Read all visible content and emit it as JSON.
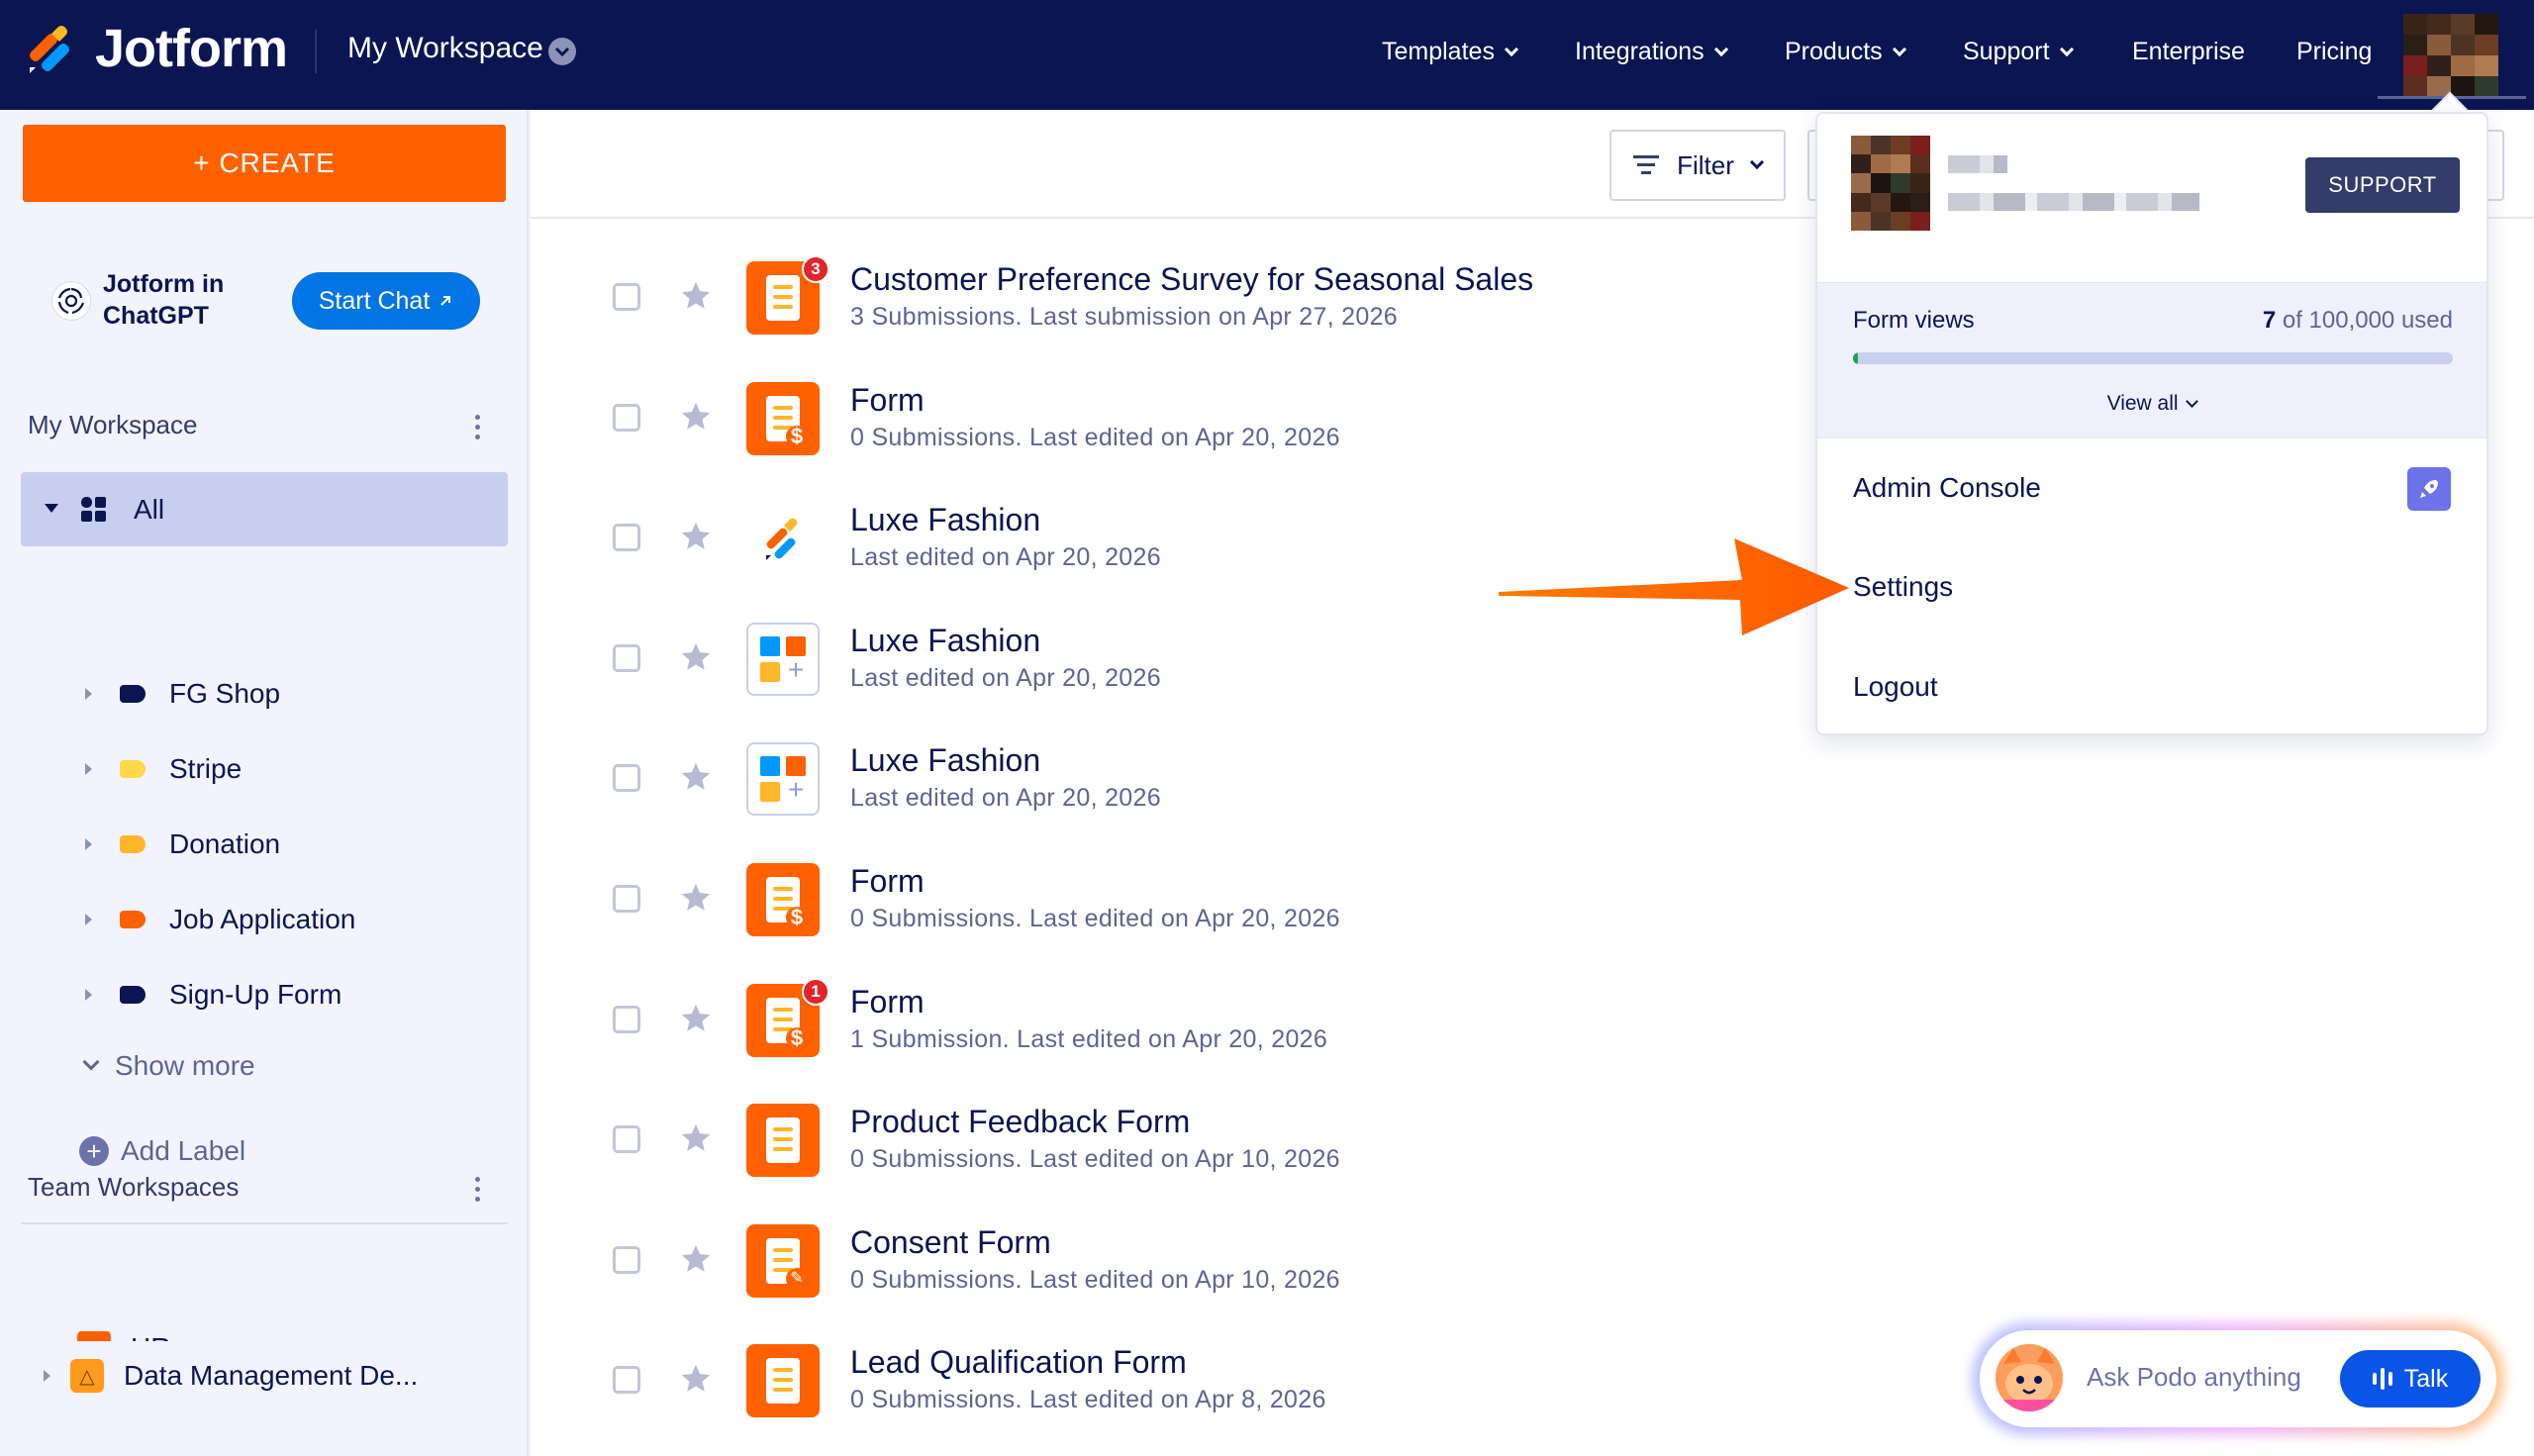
{
  "nav": {
    "brand": "Jotform",
    "workspace_title": "My Workspace",
    "links": [
      {
        "label": "Templates",
        "dropdown": true
      },
      {
        "label": "Integrations",
        "dropdown": true
      },
      {
        "label": "Products",
        "dropdown": true
      },
      {
        "label": "Support",
        "dropdown": true
      },
      {
        "label": "Enterprise",
        "dropdown": false
      },
      {
        "label": "Pricing",
        "dropdown": false
      }
    ]
  },
  "sidebar": {
    "create_label": "+ CREATE",
    "chatgpt_label": "Jotform in ChatGPT",
    "start_chat_label": "Start Chat",
    "my_workspace_title": "My Workspace",
    "all_label": "All",
    "labels": [
      {
        "name": "FG Shop",
        "color": "#0a1551"
      },
      {
        "name": "Stripe",
        "color": "#ffd84a"
      },
      {
        "name": "Donation",
        "color": "#ffb629"
      },
      {
        "name": "Job Application",
        "color": "#ff6100"
      },
      {
        "name": "Sign-Up Form",
        "color": "#0a1551"
      }
    ],
    "show_more_label": "Show more",
    "add_label": "Add Label",
    "team_title": "Team Workspaces",
    "team_item": "Data Management De...",
    "team_item_partial": "HR"
  },
  "toolbar": {
    "filter_label": "Filter"
  },
  "forms": [
    {
      "title": "Customer Preference Survey for Seasonal Sales",
      "meta": "3 Submissions. Last submission on Apr 27, 2026",
      "icon": "form-icon",
      "badge": "3"
    },
    {
      "title": "Form",
      "meta": "0 Submissions. Last edited on Apr 20, 2026",
      "icon": "payment-form-icon",
      "badge": null
    },
    {
      "title": "Luxe Fashion",
      "meta": "Last edited on Apr 20, 2026",
      "icon": "jotform-logo-icon",
      "badge": null
    },
    {
      "title": "Luxe Fashion",
      "meta": "Last edited on Apr 20, 2026",
      "icon": "app-icon",
      "badge": null
    },
    {
      "title": "Luxe Fashion",
      "meta": "Last edited on Apr 20, 2026",
      "icon": "app-icon",
      "badge": null
    },
    {
      "title": "Form",
      "meta": "0 Submissions. Last edited on Apr 20, 2026",
      "icon": "payment-form-icon",
      "badge": null
    },
    {
      "title": "Form",
      "meta": "1 Submission. Last edited on Apr 20, 2026",
      "icon": "payment-form-icon",
      "badge": "1"
    },
    {
      "title": "Product Feedback Form",
      "meta": "0 Submissions. Last edited on Apr 10, 2026",
      "icon": "form-icon",
      "badge": null
    },
    {
      "title": "Consent Form",
      "meta": "0 Submissions. Last edited on Apr 10, 2026",
      "icon": "sign-form-icon",
      "badge": null
    },
    {
      "title": "Lead Qualification Form",
      "meta": "0 Submissions. Last edited on Apr 8, 2026",
      "icon": "form-icon",
      "badge": null
    }
  ],
  "account_menu": {
    "support_label": "SUPPORT",
    "form_views_label": "Form views",
    "form_views_count": "7",
    "form_views_total": " of 100,000 used",
    "form_views_fraction": 7e-05,
    "view_all_label": "View all",
    "admin_console_label": "Admin Console",
    "settings_label": "Settings",
    "logout_label": "Logout"
  },
  "podo": {
    "placeholder": "Ask Podo anything",
    "talk_label": "Talk"
  },
  "colors": {
    "nav_bg": "#0a1551",
    "create_orange": "#ff6100",
    "accent_blue": "#0075e3",
    "annotation_arrow": "#ff6a00"
  }
}
